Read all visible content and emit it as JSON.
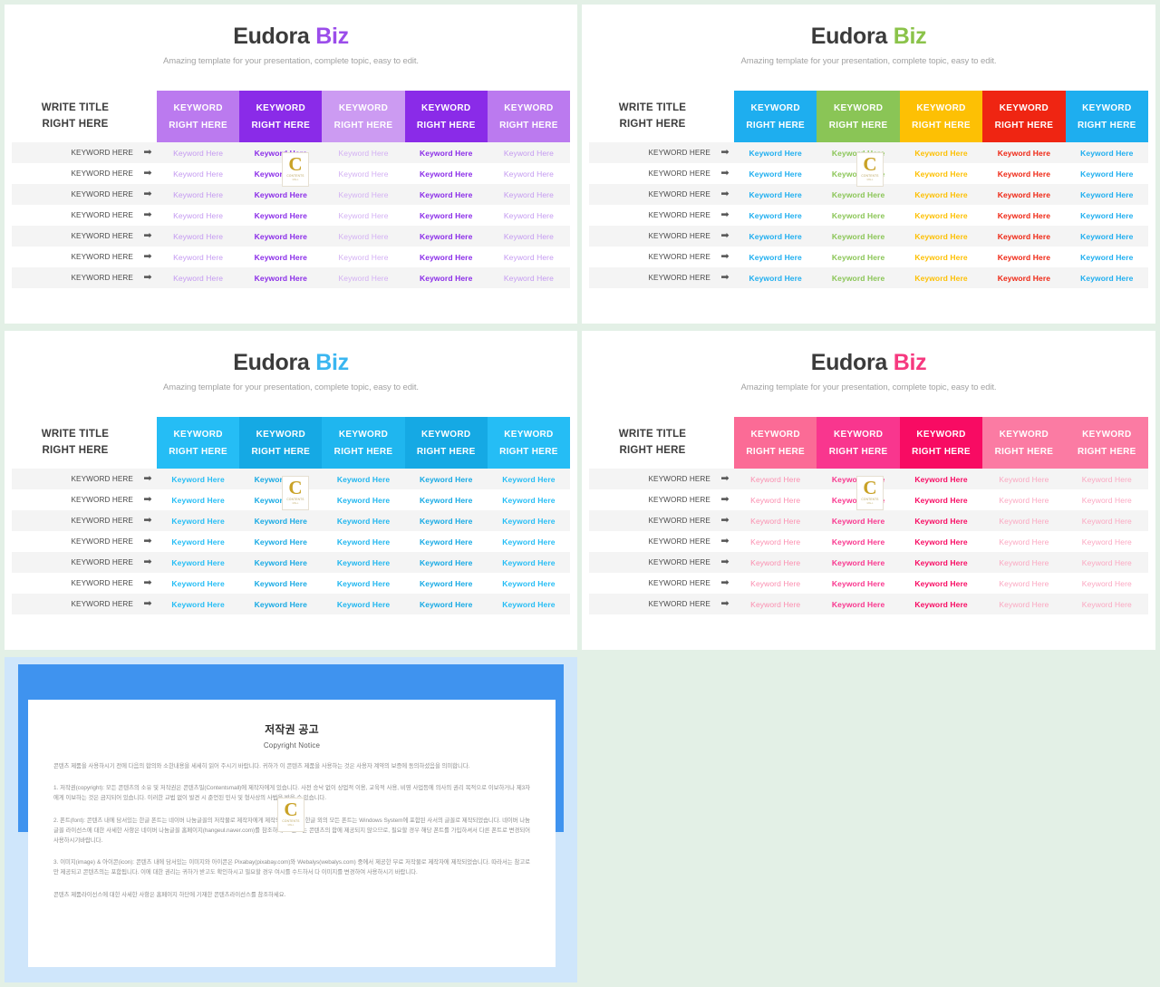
{
  "background": {
    "page": "#e3f0e6"
  },
  "slides": [
    {
      "id": "slide-purple",
      "title_main": "Eudora",
      "title_accent": "Biz",
      "accent_color": "#9b4dea",
      "subtitle": "Amazing template for your presentation, complete topic, easy to edit.",
      "row_title_line1": "WRITE TITLE",
      "row_title_line2": "RIGHT HERE",
      "header_cells": [
        {
          "line1": "KEYWORD",
          "line2": "RIGHT HERE",
          "color": "#bb7aef"
        },
        {
          "line1": "KEYWORD",
          "line2": "RIGHT HERE",
          "color": "#8a2be8"
        },
        {
          "line1": "KEYWORD",
          "line2": "RIGHT HERE",
          "color": "#cc9bf2"
        },
        {
          "line1": "KEYWORD",
          "line2": "RIGHT HERE",
          "color": "#8a2be8"
        },
        {
          "line1": "KEYWORD",
          "line2": "RIGHT HERE",
          "color": "#bb7aef"
        }
      ],
      "cell_colors": [
        "#c49af0",
        "#8a2be8",
        "#d3b0f3",
        "#8a2be8",
        "#c49af0"
      ],
      "cell_weights": [
        "soft",
        "strong",
        "soft",
        "strong",
        "soft"
      ],
      "row_label": "KEYWORD HERE",
      "cell_text": "Keyword Here",
      "arrow": "➡",
      "row_count": 7
    },
    {
      "id": "slide-multicolor",
      "title_main": "Eudora",
      "title_accent": "Biz",
      "accent_color": "#8bc34a",
      "subtitle": "Amazing template for your presentation, complete topic, easy to edit.",
      "row_title_line1": "WRITE TITLE",
      "row_title_line2": "RIGHT HERE",
      "header_cells": [
        {
          "line1": "KEYWORD",
          "line2": "RIGHT HERE",
          "color": "#1eaeef"
        },
        {
          "line1": "KEYWORD",
          "line2": "RIGHT HERE",
          "color": "#8ac556"
        },
        {
          "line1": "KEYWORD",
          "line2": "RIGHT HERE",
          "color": "#fdc004"
        },
        {
          "line1": "KEYWORD",
          "line2": "RIGHT HERE",
          "color": "#ef2512"
        },
        {
          "line1": "KEYWORD",
          "line2": "RIGHT HERE",
          "color": "#1eaeef"
        }
      ],
      "cell_colors": [
        "#1eaeef",
        "#8ac556",
        "#fdc004",
        "#ef2512",
        "#1eaeef"
      ],
      "cell_weights": [
        "strong",
        "strong",
        "strong",
        "strong",
        "strong"
      ],
      "row_label": "KEYWORD HERE",
      "cell_text": "Keyword Here",
      "arrow": "➡",
      "row_count": 7
    },
    {
      "id": "slide-blue",
      "title_main": "Eudora",
      "title_accent": "Biz",
      "accent_color": "#3ab6f0",
      "subtitle": "Amazing template for your presentation, complete topic, easy to edit.",
      "row_title_line1": "WRITE TITLE",
      "row_title_line2": "RIGHT HERE",
      "header_cells": [
        {
          "line1": "KEYWORD",
          "line2": "RIGHT HERE",
          "color": "#25bdf5"
        },
        {
          "line1": "KEYWORD",
          "line2": "RIGHT HERE",
          "color": "#15a9e4"
        },
        {
          "line1": "KEYWORD",
          "line2": "RIGHT HERE",
          "color": "#1fb6ef"
        },
        {
          "line1": "KEYWORD",
          "line2": "RIGHT HERE",
          "color": "#15a9e4"
        },
        {
          "line1": "KEYWORD",
          "line2": "RIGHT HERE",
          "color": "#25bdf5"
        }
      ],
      "cell_colors": [
        "#25bdf5",
        "#15a9e4",
        "#1fb6ef",
        "#15a9e4",
        "#25bdf5"
      ],
      "cell_weights": [
        "strong",
        "strong",
        "strong",
        "strong",
        "strong"
      ],
      "row_label": "KEYWORD HERE",
      "cell_text": "Keyword Here",
      "arrow": "➡",
      "row_count": 7
    },
    {
      "id": "slide-pink",
      "title_main": "Eudora",
      "title_accent": "Biz",
      "accent_color": "#f6397f",
      "subtitle": "Amazing template for your presentation, complete topic, easy to edit.",
      "row_title_line1": "WRITE TITLE",
      "row_title_line2": "RIGHT HERE",
      "header_cells": [
        {
          "line1": "KEYWORD",
          "line2": "RIGHT HERE",
          "color": "#fb6b96"
        },
        {
          "line1": "KEYWORD",
          "line2": "RIGHT HERE",
          "color": "#f9368e"
        },
        {
          "line1": "KEYWORD",
          "line2": "RIGHT HERE",
          "color": "#f80b63"
        },
        {
          "line1": "KEYWORD",
          "line2": "RIGHT HERE",
          "color": "#fb7ba3"
        },
        {
          "line1": "KEYWORD",
          "line2": "RIGHT HERE",
          "color": "#fb7ba3"
        }
      ],
      "cell_colors": [
        "#fb8fb0",
        "#f9368e",
        "#f80b63",
        "#fba7c1",
        "#fba7c1"
      ],
      "cell_weights": [
        "soft",
        "strong",
        "strong",
        "soft",
        "soft"
      ],
      "row_label": "KEYWORD HERE",
      "cell_text": "Keyword Here",
      "arrow": "➡",
      "row_count": 7
    }
  ],
  "watermark": {
    "letter": "C",
    "caption": "CONTENTS",
    "caption2": "MALL"
  },
  "copyright": {
    "heading_ko": "저작권 공고",
    "heading_en": "Copyright Notice",
    "intro": "콘텐츠 제품을 사용하시기 전에 다음의 합의와 소한내용을 세세히 읽어 주시기 바랍니다. 귀하가 이 콘텐츠 제품을 사용하는 것은 사용자 계약의 보증에 동의하셨음을 의미합니다.",
    "section1": "1. 저작권(copyright): 모든 콘텐츠의 소유 및 저작권은 콘텐츠밀(Contentsmall)에 제작자에게 있습니다. 사전 승낙 없이 상업적 이용, 교육적 사용, 비영 사업등에 의사의 권리 목적으로 이보하거나 제3자에게 이보하는 것은 금지되어 있습니다. 이러한 교법 없이 발견 시 준언된 민사 및 형사상의 사법을 받을 수 있습니다.",
    "section2": "2. 폰트(font): 콘텐츠 내에 담서있는 한글 폰트는 네이버 나눔글꼴의 저작물로 제작자에게 제작되었습니다. 한글 외의 모든 폰트는 Windows System에 포함된 사서의 글꼴로 제작되었습니다. 네이버 나눔글꼴 라이선스에 대한 사세한 사항은 네이버 나눔글꼴 홈페이지(hangeul.naver.com)를 참조하세요. 폰트는 콘텐츠의 함에 제공되지 않으므로, 필요할 경우 해당 폰트를 가입하셔서 다른 폰트로 변경되어 사용하시기바랍니다.",
    "section3": "3. 이미지(image) & 아이콘(icon): 콘텐츠 내에 담서있는 이미지와 아이콘은 Pixabay(pixabay.com)와 Webalys(webalys.com) 중에서 제공한 무료 저작물로 제작자에 제작되었습니다. 따라서는 참고로만 제공되고 콘텐츠의는 포함됩니다. 이에 대한 권리는 귀하가 받고도 확인하시고 필요할 경우 여시를 수드하서 다 이미지를 변경하여 사용하시기 바랍니다.",
    "outro": "콘텐츠 제품라이선스에 대한 사세한 사항은 홈페이지 하단에 기재한 콘텐츠라이선스를 참조하세요."
  }
}
